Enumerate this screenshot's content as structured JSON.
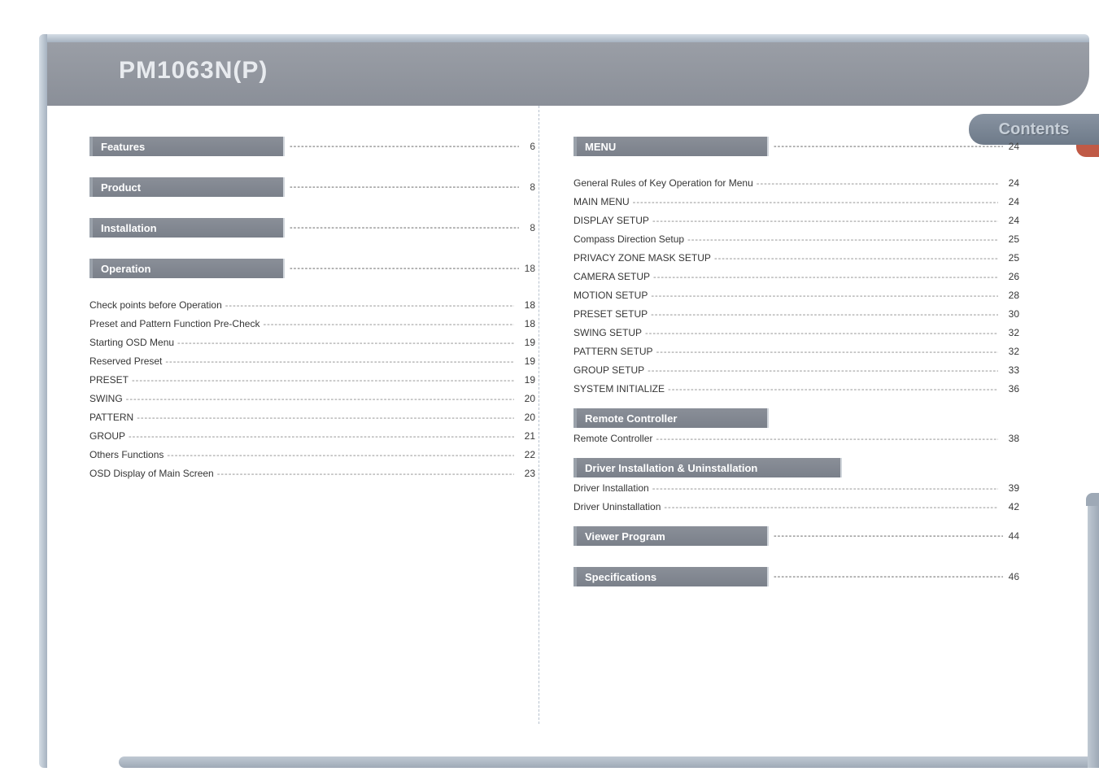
{
  "header": {
    "title": "PM1063N(P)"
  },
  "tab": {
    "label": "Contents"
  },
  "left": {
    "sections": [
      {
        "title": "Features",
        "page": "6",
        "items": []
      },
      {
        "title": "Product",
        "page": "8",
        "items": []
      },
      {
        "title": "Installation",
        "page": "8",
        "items": []
      },
      {
        "title": "Operation",
        "page": "18",
        "items": [
          {
            "label": "Check points before Operation",
            "page": "18"
          },
          {
            "label": "Preset and Pattern Function Pre-Check",
            "page": "18"
          },
          {
            "label": "Starting OSD Menu",
            "page": "19"
          },
          {
            "label": "Reserved Preset",
            "page": "19"
          },
          {
            "label": "PRESET",
            "page": "19"
          },
          {
            "label": "SWING",
            "page": "20"
          },
          {
            "label": "PATTERN",
            "page": "20"
          },
          {
            "label": "GROUP",
            "page": "21"
          },
          {
            "label": "Others Functions",
            "page": "22"
          },
          {
            "label": "OSD Display of Main Screen",
            "page": "23"
          }
        ]
      }
    ]
  },
  "right": {
    "sections": [
      {
        "title": "MENU",
        "page": "24",
        "items": [
          {
            "label": "General Rules of Key Operation for Menu",
            "page": "24"
          },
          {
            "label": "MAIN MENU",
            "page": "24"
          },
          {
            "label": "DISPLAY SETUP",
            "page": "24"
          },
          {
            "label": "Compass Direction Setup",
            "page": "25"
          },
          {
            "label": "PRIVACY ZONE MASK SETUP",
            "page": "25"
          },
          {
            "label": "CAMERA SETUP",
            "page": "26"
          },
          {
            "label": "MOTION SETUP",
            "page": "28"
          },
          {
            "label": "PRESET SETUP",
            "page": "30"
          },
          {
            "label": "SWING SETUP",
            "page": "32"
          },
          {
            "label": "PATTERN SETUP",
            "page": "32"
          },
          {
            "label": "GROUP SETUP",
            "page": "33"
          },
          {
            "label": "SYSTEM INITIALIZE",
            "page": "36"
          }
        ]
      },
      {
        "title": "Remote Controller",
        "page": "",
        "items": [
          {
            "label": "Remote Controller",
            "page": "38"
          }
        ]
      },
      {
        "title": "Driver Installation & Uninstallation",
        "page": "",
        "items": [
          {
            "label": "Driver Installation",
            "page": "39"
          },
          {
            "label": "Driver Uninstallation",
            "page": "42"
          }
        ]
      },
      {
        "title": "Viewer Program",
        "page": "44",
        "items": []
      },
      {
        "title": "Specifications",
        "page": "46",
        "items": []
      }
    ]
  },
  "dashes": "--------------------------------------------------------------------------------------------------------------------------------------------"
}
